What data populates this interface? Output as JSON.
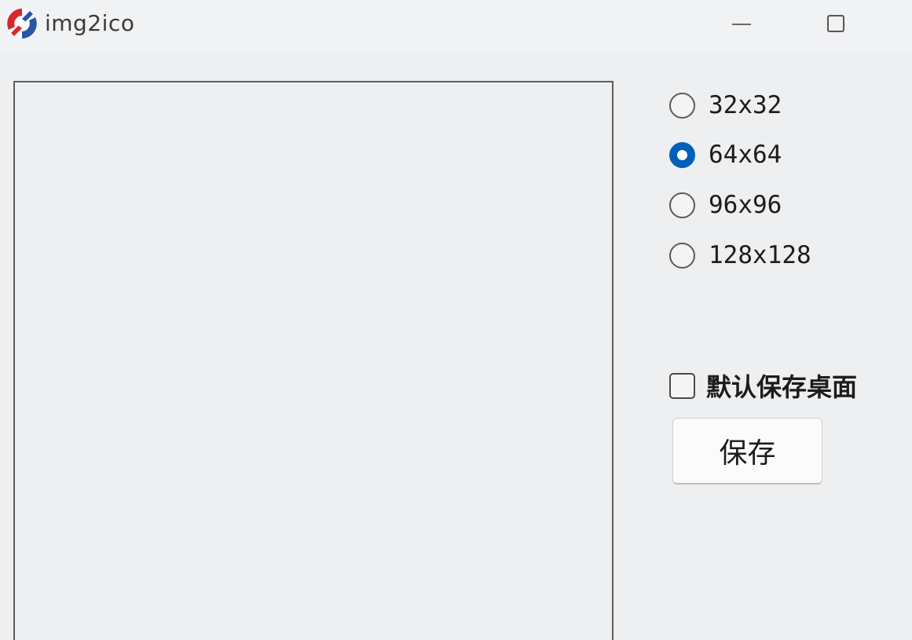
{
  "window": {
    "title": "img2ico",
    "minimize_symbol": "—",
    "maximize_symbol": "☐"
  },
  "sizes": {
    "options": [
      {
        "label": "32x32",
        "checked": false
      },
      {
        "label": "64x64",
        "checked": true
      },
      {
        "label": "96x96",
        "checked": false
      },
      {
        "label": "128x128",
        "checked": false
      }
    ],
    "selected": "64x64"
  },
  "options": {
    "save_to_desktop_label": "默认保存桌面",
    "save_to_desktop_checked": false
  },
  "actions": {
    "save_label": "保存"
  },
  "colors": {
    "accent": "#005fb8",
    "background": "#eeeff1",
    "icon_red": "#d9262e",
    "icon_blue": "#2b54a6"
  },
  "icons": {
    "app_icon": "app-logo-icon",
    "minimize": "minimize-icon",
    "maximize": "maximize-icon"
  }
}
